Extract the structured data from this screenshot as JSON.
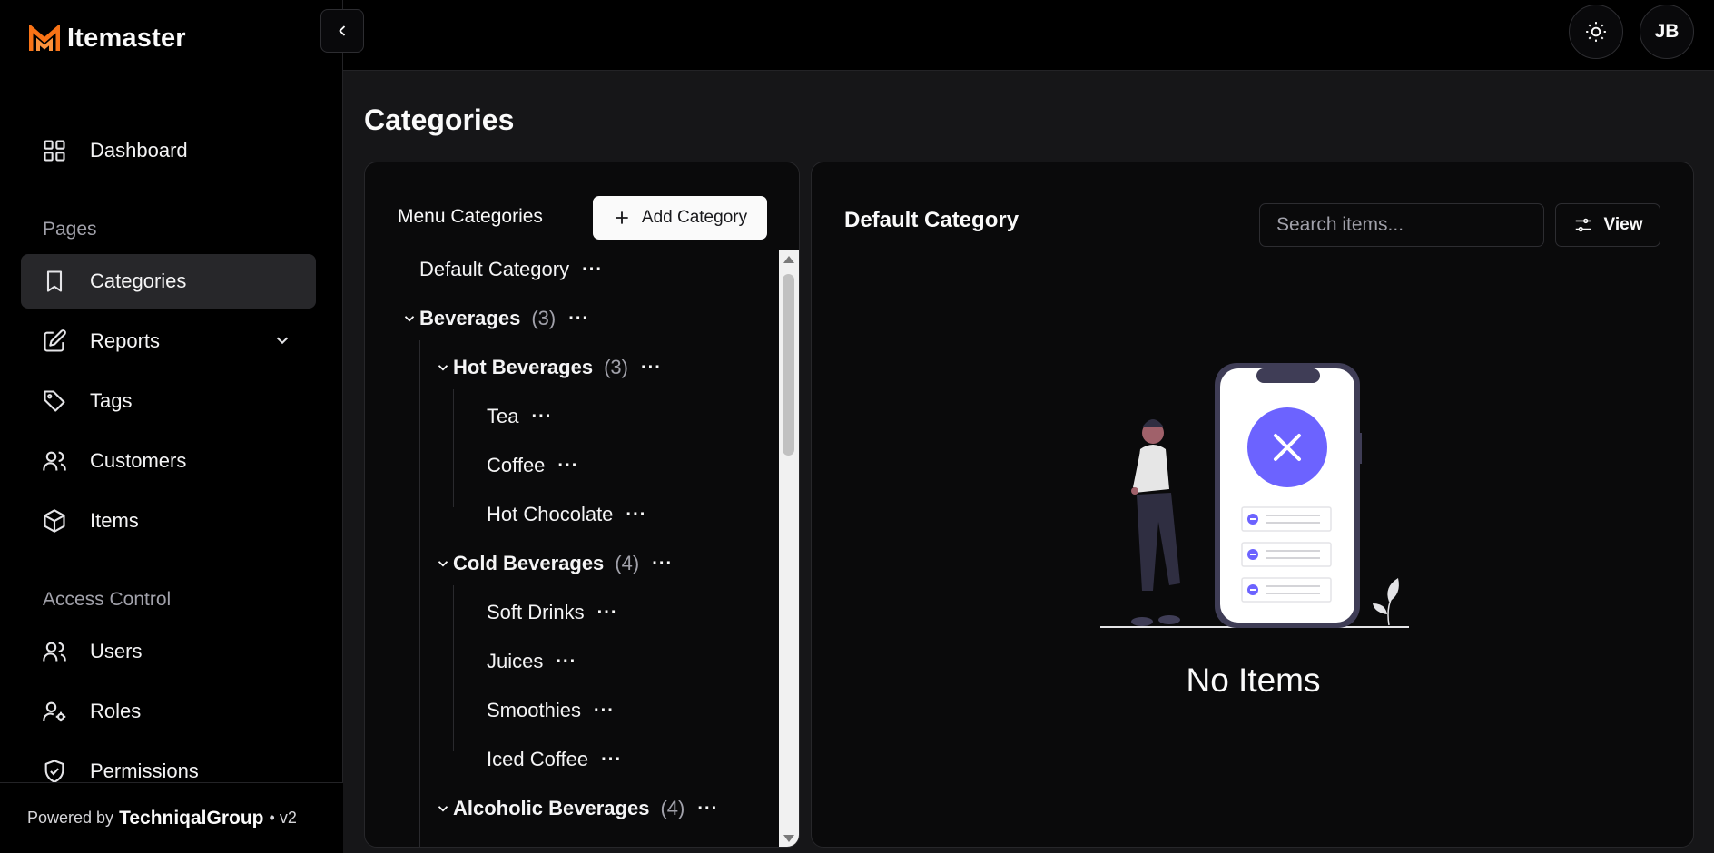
{
  "app": {
    "name": "Itemaster"
  },
  "header": {
    "avatar_initials": "JB"
  },
  "sidebar": {
    "dashboard": "Dashboard",
    "section_pages": "Pages",
    "categories": "Categories",
    "reports": "Reports",
    "tags": "Tags",
    "customers": "Customers",
    "items": "Items",
    "section_access": "Access Control",
    "users": "Users",
    "roles": "Roles",
    "permissions": "Permissions",
    "footer": {
      "powered_by": "Powered by",
      "brand": "TechniqalGroup",
      "version": "• v2"
    }
  },
  "page": {
    "title": "Categories"
  },
  "menu_categories": {
    "title": "Menu Categories",
    "add_label": "Add Category",
    "tree": {
      "default": {
        "name": "Default Category"
      },
      "beverages": {
        "name": "Beverages",
        "count": "(3)"
      },
      "hot": {
        "name": "Hot Beverages",
        "count": "(3)"
      },
      "tea": {
        "name": "Tea"
      },
      "coffee": {
        "name": "Coffee"
      },
      "hot_chocolate": {
        "name": "Hot Chocolate"
      },
      "cold": {
        "name": "Cold Beverages",
        "count": "(4)"
      },
      "soft_drinks": {
        "name": "Soft Drinks"
      },
      "juices": {
        "name": "Juices"
      },
      "smoothies": {
        "name": "Smoothies"
      },
      "iced_coffee": {
        "name": "Iced Coffee"
      },
      "alcoholic": {
        "name": "Alcoholic Beverages",
        "count": "(4)"
      }
    },
    "more": "···"
  },
  "detail": {
    "title": "Default Category",
    "search_placeholder": "Search items...",
    "view_label": "View",
    "empty_text": "No Items"
  },
  "colors": {
    "accent": "#6c63ff",
    "logo": "#f97316"
  }
}
